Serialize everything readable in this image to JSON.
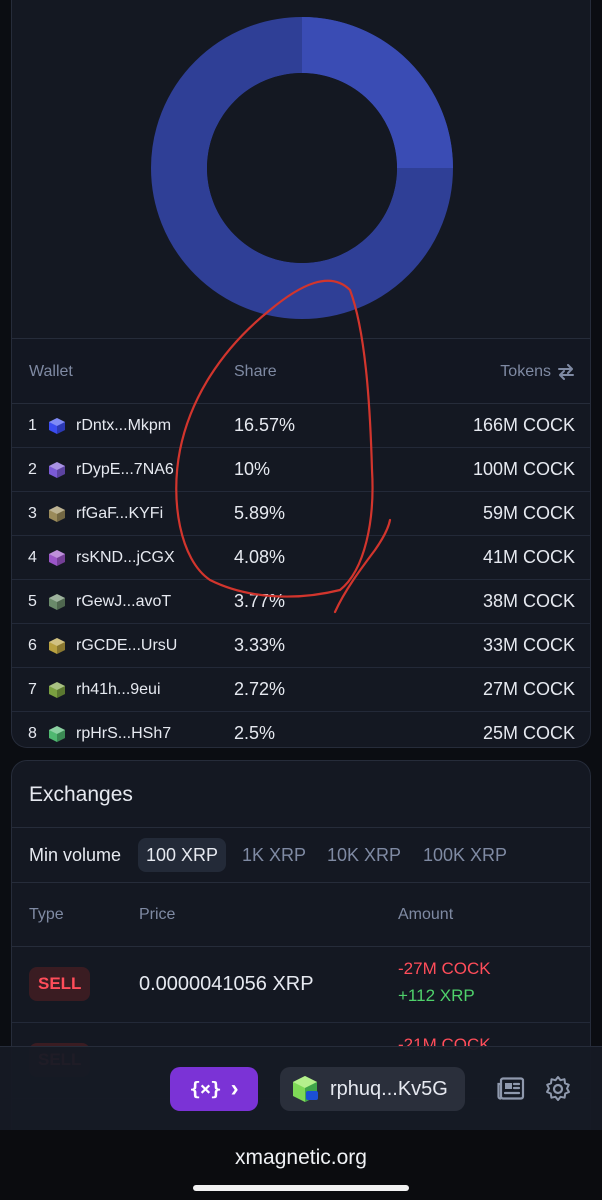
{
  "holders": {
    "headers": {
      "wallet": "Wallet",
      "share": "Share",
      "tokens": "Tokens"
    },
    "rows": [
      {
        "rank": "1",
        "address": "rDntx...Mkpm",
        "share": "16.57%",
        "tokens": "166M COCK",
        "color": "#3b4cf0"
      },
      {
        "rank": "2",
        "address": "rDypE...7NA6",
        "share": "10%",
        "tokens": "100M COCK",
        "color": "#7b5ad6"
      },
      {
        "rank": "3",
        "address": "rfGaF...KYFi",
        "share": "5.89%",
        "tokens": "59M COCK",
        "color": "#9a8a5a"
      },
      {
        "rank": "4",
        "address": "rsKND...jCGX",
        "share": "4.08%",
        "tokens": "41M COCK",
        "color": "#9b55c8"
      },
      {
        "rank": "5",
        "address": "rGewJ...avoT",
        "share": "3.77%",
        "tokens": "38M COCK",
        "color": "#6a8a6a"
      },
      {
        "rank": "6",
        "address": "rGCDE...UrsU",
        "share": "3.33%",
        "tokens": "33M COCK",
        "color": "#b8a040"
      },
      {
        "rank": "7",
        "address": "rh41h...9eui",
        "share": "2.72%",
        "tokens": "27M COCK",
        "color": "#7aa040"
      },
      {
        "rank": "8",
        "address": "rpHrS...HSh7",
        "share": "2.5%",
        "tokens": "25M COCK",
        "color": "#4fb870"
      }
    ]
  },
  "exchanges": {
    "title": "Exchanges",
    "min_volume_label": "Min volume",
    "volume_options": [
      "100 XRP",
      "1K XRP",
      "10K XRP",
      "100K XRP"
    ],
    "selected_volume": "100 XRP",
    "headers": {
      "type": "Type",
      "price": "Price",
      "amount": "Amount"
    },
    "rows": [
      {
        "type": "SELL",
        "price": "0.0000041056 XRP",
        "amount_token": "-27M COCK",
        "amount_xrp": "+112 XRP"
      },
      {
        "type": "SELL",
        "price": "",
        "amount_token": "-21M COCK",
        "amount_xrp": ""
      }
    ]
  },
  "bottom_bar": {
    "wallet_label": "rphuq...Kv5G"
  },
  "browser": {
    "url": "xmagnetic.org"
  },
  "colors": {
    "donut": "#3547a8",
    "sell": "#ff4d5a",
    "buy": "#4fd16b",
    "accent": "#7b33d6"
  }
}
